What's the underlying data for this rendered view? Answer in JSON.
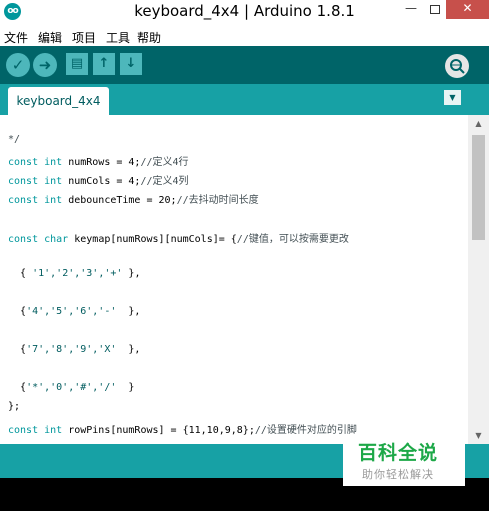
{
  "window": {
    "title": "keyboard_4x4 | Arduino 1.8.1",
    "app_icon_label": "oo",
    "minimize_glyph": "—",
    "close_glyph": "✕"
  },
  "menu": {
    "items": [
      "文件",
      "编辑",
      "项目",
      "工具",
      "帮助"
    ]
  },
  "toolbar": {
    "verify_icon": "check-icon",
    "upload_icon": "arrow-right-icon",
    "new_icon": "file-icon",
    "open_icon": "arrow-up-icon",
    "save_icon": "arrow-down-icon",
    "serial_monitor_icon": "magnifier-icon",
    "color": "#006468"
  },
  "tabs": [
    {
      "label": "keyboard_4x4"
    }
  ],
  "editor": {
    "lines": [
      [
        {
          "t": "*/",
          "c": "cm"
        }
      ],
      [
        {
          "t": "const int",
          "c": "kw"
        },
        {
          "t": " numRows = 4;",
          "c": ""
        },
        {
          "t": "//定义4行",
          "c": "cm"
        }
      ],
      [
        {
          "t": "const int",
          "c": "kw"
        },
        {
          "t": " numCols = 4;",
          "c": ""
        },
        {
          "t": "//定义4列",
          "c": "cm"
        }
      ],
      [
        {
          "t": "const int",
          "c": "kw"
        },
        {
          "t": " debounceTime = 20;",
          "c": ""
        },
        {
          "t": "//去抖动时间长度",
          "c": "cm"
        }
      ],
      [],
      [
        {
          "t": "const char",
          "c": "kw"
        },
        {
          "t": " keymap[numRows][numCols]= {",
          "c": ""
        },
        {
          "t": "//键值，可以按需要更改",
          "c": "cm"
        }
      ],
      [],
      [
        {
          "t": "  { ",
          "c": ""
        },
        {
          "t": "'1','2','3','+'",
          "c": "str"
        },
        {
          "t": " },",
          "c": ""
        }
      ],
      [],
      [
        {
          "t": "  {",
          "c": ""
        },
        {
          "t": "'4','5','6','-'",
          "c": "str"
        },
        {
          "t": "  },",
          "c": ""
        }
      ],
      [],
      [
        {
          "t": "  {",
          "c": ""
        },
        {
          "t": "'7','8','9','X'",
          "c": "str"
        },
        {
          "t": "  },",
          "c": ""
        }
      ],
      [],
      [
        {
          "t": "  {",
          "c": ""
        },
        {
          "t": "'*','0','#','/'",
          "c": "str"
        },
        {
          "t": "  }",
          "c": ""
        }
      ],
      [
        {
          "t": "};",
          "c": ""
        }
      ],
      [
        {
          "t": "const int",
          "c": "kw"
        },
        {
          "t": " rowPins[numRows] = {11,10,9,8};",
          "c": ""
        },
        {
          "t": "//设置硬件对应的引脚",
          "c": "cm"
        }
      ]
    ]
  },
  "watermark": {
    "title": "百科全说",
    "subtitle": "助你轻松解决"
  },
  "colors": {
    "keyword": "#00979c",
    "comment": "#434f54",
    "string": "#005c5f",
    "tab_bar": "#17a1a5",
    "console": "#000000",
    "close_button": "#c7504b"
  }
}
